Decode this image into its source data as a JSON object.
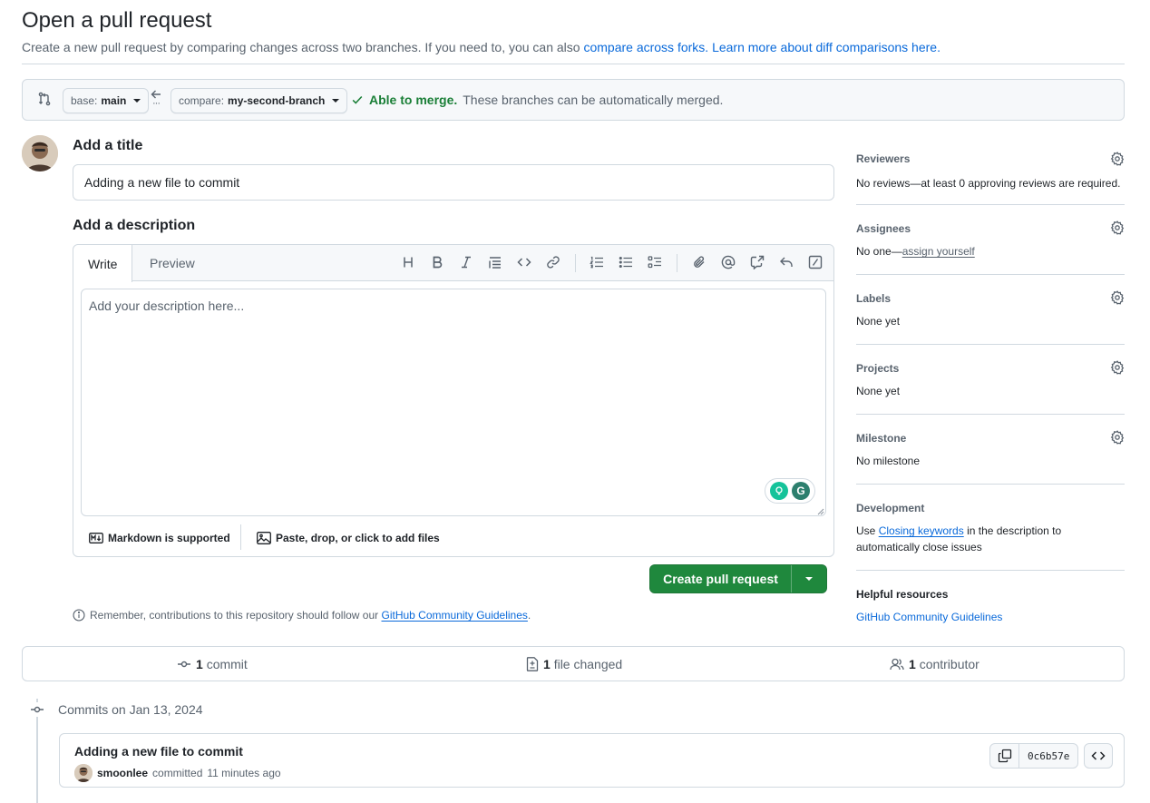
{
  "header": {
    "title": "Open a pull request",
    "subtitle_prefix": "Create a new pull request by comparing changes across two branches. If you need to, you can also ",
    "compare_forks_link": "compare across forks.",
    "learn_more_link": "Learn more about diff comparisons here."
  },
  "range": {
    "base_label": "base:",
    "base_branch": "main",
    "compare_label": "compare:",
    "compare_branch": "my-second-branch",
    "merge_ok": "Able to merge.",
    "merge_detail": "These branches can be automatically merged."
  },
  "form": {
    "title_heading": "Add a title",
    "title_value": "Adding a new file to commit",
    "desc_heading": "Add a description",
    "tab_write": "Write",
    "tab_preview": "Preview",
    "desc_placeholder": "Add your description here...",
    "markdown_note": "Markdown is supported",
    "attach_note": "Paste, drop, or click to add files",
    "create_button": "Create pull request",
    "remember_prefix": "Remember, contributions to this repository should follow our ",
    "remember_link": "GitHub Community Guidelines",
    "remember_suffix": "."
  },
  "sidebar": {
    "reviewers": {
      "heading": "Reviewers",
      "value": "No reviews—at least 0 approving reviews are required."
    },
    "assignees": {
      "heading": "Assignees",
      "value_prefix": "No one—",
      "value_link": "assign yourself"
    },
    "labels": {
      "heading": "Labels",
      "value": "None yet"
    },
    "projects": {
      "heading": "Projects",
      "value": "None yet"
    },
    "milestone": {
      "heading": "Milestone",
      "value": "No milestone"
    },
    "development": {
      "heading": "Development",
      "prefix": "Use ",
      "link": "Closing keywords",
      "suffix": " in the description to automatically close issues"
    },
    "resources": {
      "heading": "Helpful resources",
      "link": "GitHub Community Guidelines"
    }
  },
  "stats": {
    "commits_count": "1",
    "commits_label": "commit",
    "files_count": "1",
    "files_label": "file changed",
    "contributors_count": "1",
    "contributors_label": "contributor"
  },
  "commits": {
    "date_heading": "Commits on Jan 13, 2024",
    "items": [
      {
        "message": "Adding a new file to commit",
        "author": "smoonlee",
        "action": "committed",
        "time": "11 minutes ago",
        "sha": "0c6b57e"
      }
    ]
  },
  "colors": {
    "accent": "#0969da",
    "success": "#1a7f37",
    "button_green": "#1f883d",
    "border": "#d1d9e0",
    "muted": "#59636e"
  },
  "grammarly": {
    "badge_letter": "G"
  }
}
